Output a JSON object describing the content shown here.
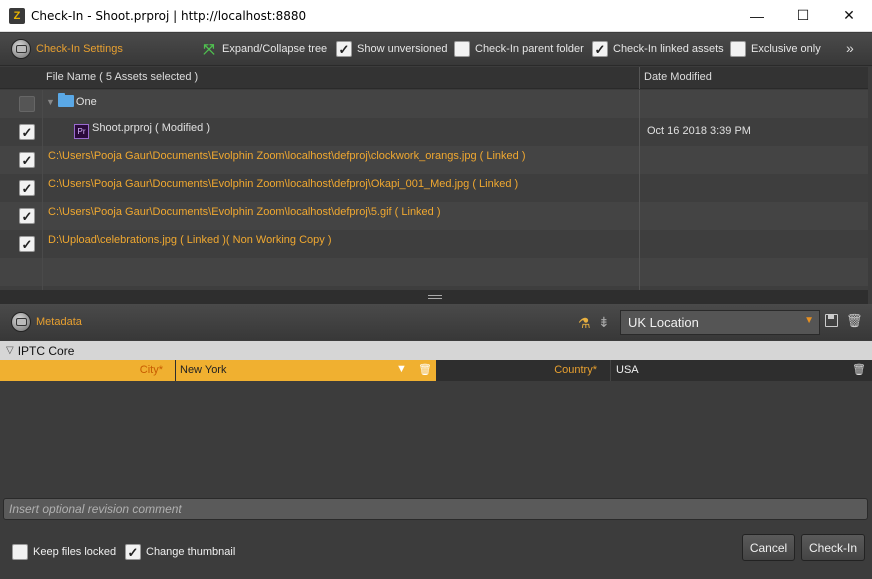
{
  "window": {
    "app_icon_letter": "Z",
    "title": "Check-In - Shoot.prproj | http://localhost:8880",
    "minimize": "—",
    "maximize": "☐",
    "close": "✕"
  },
  "settings": {
    "title": "Check-In Settings",
    "expand_label": "Expand/Collapse tree",
    "options": [
      {
        "label": "Show unversioned",
        "checked": true
      },
      {
        "label": "Check-In parent folder",
        "checked": false
      },
      {
        "label": "Check-In linked assets",
        "checked": true
      },
      {
        "label": "Exclusive only",
        "checked": false
      }
    ],
    "more": "»"
  },
  "table": {
    "col_file": "File Name ( 5 Assets selected )",
    "col_date": "Date Modified",
    "rows": [
      {
        "name": "One",
        "date": "",
        "type": "folder",
        "checked": false
      },
      {
        "name": "Shoot.prproj ( Modified )",
        "date": "Oct 16 2018 3:39 PM",
        "type": "project",
        "checked": true
      },
      {
        "name": "C:\\Users\\Pooja Gaur\\Documents\\Evolphin Zoom\\localhost\\defproj\\clockwork_orangs.jpg ( Linked )",
        "date": "",
        "type": "linked",
        "checked": true
      },
      {
        "name": "C:\\Users\\Pooja Gaur\\Documents\\Evolphin Zoom\\localhost\\defproj\\Okapi_001_Med.jpg ( Linked )",
        "date": "",
        "type": "linked",
        "checked": true
      },
      {
        "name": "C:\\Users\\Pooja Gaur\\Documents\\Evolphin Zoom\\localhost\\defproj\\5.gif ( Linked )",
        "date": "",
        "type": "linked",
        "checked": true
      },
      {
        "name": "D:\\Upload\\celebrations.jpg ( Linked )( Non Working Copy )",
        "date": "",
        "type": "linked",
        "checked": true
      }
    ]
  },
  "metadata": {
    "title": "Metadata",
    "preset": "UK Location",
    "group": "IPTC Core",
    "city_label": "City*",
    "city_value": "New York",
    "country_label": "Country*",
    "country_value": "USA"
  },
  "footer": {
    "comment_placeholder": "Insert optional revision comment",
    "keep_locked": {
      "label": "Keep files locked",
      "checked": false
    },
    "change_thumb": {
      "label": "Change thumbnail",
      "checked": true
    },
    "cancel": "Cancel",
    "checkin": "Check-In"
  }
}
